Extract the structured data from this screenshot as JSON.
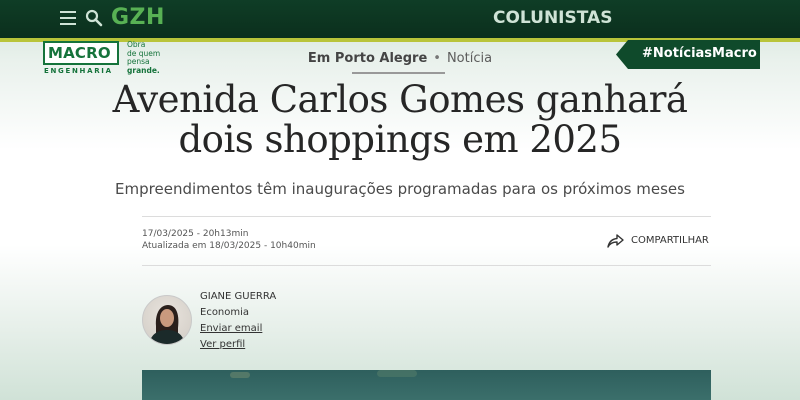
{
  "header": {
    "logo": "GZH",
    "section": "COLUNISTAS",
    "menu_icon": "menu-icon",
    "search_icon": "search-icon"
  },
  "sponsor": {
    "brand": "MACRO",
    "brand_sub": "ENGENHARIA",
    "tagline_lines": [
      "Obra",
      "de quem",
      "pensa",
      "grande."
    ],
    "hashtag": "#NotíciasMacro"
  },
  "article": {
    "kicker_place": "Em Porto Alegre",
    "kicker_separator": "•",
    "kicker_type": "Notícia",
    "headline": "Avenida Carlos Gomes ganhará dois shoppings em 2025",
    "subtitle": "Empreendimentos têm inaugurações programadas para os próximos meses",
    "published": "17/03/2025 - 20h13min",
    "updated": "Atualizada em 18/03/2025 - 10h40min",
    "share_label": "COMPARTILHAR",
    "share_icon": "share-icon"
  },
  "author": {
    "name": "GIANE GUERRA",
    "section": "Economia",
    "email_link": "Enviar email",
    "profile_link": "Ver perfil"
  },
  "colors": {
    "header_bg": "#0f3d26",
    "accent_bar": "#b9c43a",
    "gzh_green": "#58b154",
    "macro_green": "#15733b",
    "banner_bg": "#0f4a2b"
  }
}
